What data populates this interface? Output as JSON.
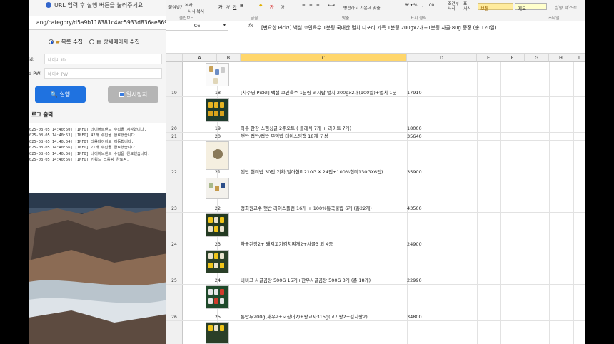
{
  "scraper": {
    "hint": "URL 입력 후 실행 버튼을 눌러주세요.",
    "url_value": "ang/category/d5a9b118381c4ac5933d836ae86926da?cp=",
    "mode_list_label": "목록 수집",
    "mode_detail_label": "상세페이지 수집",
    "id_label": "id:",
    "id_placeholder": "네이버 ID",
    "pw_label": "d PW:",
    "pw_placeholder": "네이버 PW",
    "run_label": "실행",
    "stop_label": "일시정지",
    "log_title": "로그 출력",
    "log_lines": [
      "025-08-05 14:40:50] [INFO] 네이버브랜드 수집을 시작합니다.",
      "025-08-05 14:40:53] [INFO] 42개 수집을 완료했습니다.",
      "025-08-05 14:40:54] [INFO] 다음페이지로 이동합니다.",
      "025-08-05 14:40:56] [INFO] 71개 수집을 완료했습니다.",
      "025-08-05 14:40:56] [INFO] 네이버브랜드 수집을 완료했습니다.",
      "025-08-05 14:40:56] [INFO] 키워드 크롤링 완료됨."
    ]
  },
  "excel": {
    "ribbon": {
      "paste_label": "붙여넣기",
      "copy_label": "복사",
      "format_painter_label": "서식 복사",
      "clipboard_group": "클립보드",
      "font_group": "글꼴",
      "align_group": "맞춤",
      "merge_label": "병합하고 가운데 맞춤",
      "number_group": "표시 형식",
      "percent_label": "%",
      "conditional_label": "조건부 서식",
      "table_format_label": "표 서식",
      "style_bad": "보통",
      "style_memo": "메모",
      "style_explain": "설명 텍스트",
      "styles_group": "스타일",
      "sort_label": "아"
    },
    "name_box": "C6",
    "fx": "fx",
    "formula": "[변요한 Pick!] 백설 코인육수 1분링 국내산 멸치 디포리 가득 1분링 200gx2개+1분링 사골 80g 증정 (총 120알)",
    "columns": [
      "A",
      "B",
      "C",
      "D",
      "E",
      "F",
      "G",
      "H",
      "I"
    ],
    "rows": [
      {
        "num": "19",
        "a": "18",
        "c": "[차주영 Pick!] 백설 코인육수 1분링 비지랍 멸치 200gx2개(100알)+멸치 1분",
        "d": "17910"
      },
      {
        "num": "20",
        "a": "19",
        "c": "하루 한장 스팸싱글 2주오트 ( 클래식 7개 + 라이트 7개)",
        "d": "18000"
      },
      {
        "num": "21",
        "a": "20",
        "c": "햇반 컵반/컵밥 부먹밥 테이스팅팩 18개 구성",
        "d": "35640"
      },
      {
        "num": "22",
        "a": "21",
        "c": "햇반 현미밥 30입 기획(발아현미210G X 24입+100%현미130GX6입)",
        "d": "35900"
      },
      {
        "num": "23",
        "a": "22",
        "c": "정희원교수 햇반 라이스플랜 16개 + 100%통곡물밥 6개 (총22개)",
        "d": "43500"
      },
      {
        "num": "24",
        "a": "23",
        "c": "차돌된장2+ 돼지고기김치찌개2+사골3 외 4종",
        "d": "24900"
      },
      {
        "num": "25",
        "a": "24",
        "c": "비비고 사골곰탕 500G 15개+한우사골곰탕 500G 3개 (총 18개)",
        "d": "22990"
      },
      {
        "num": "26",
        "a": "25",
        "c": "통만두200g(새우2+오징어2)+왕교자315g(고기왕2+김치왕2)",
        "d": "34800"
      },
      {
        "num": "",
        "a": "",
        "c": "",
        "d": ""
      }
    ]
  }
}
